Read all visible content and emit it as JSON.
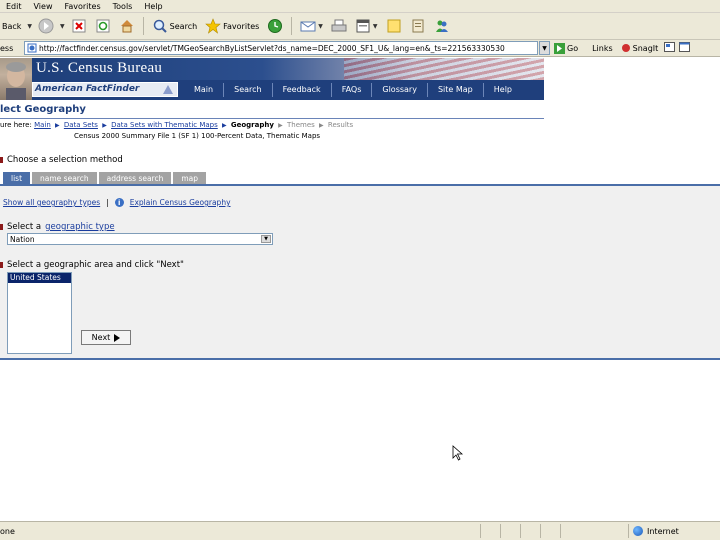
{
  "menubar": [
    "Edit",
    "View",
    "Favorites",
    "Tools",
    "Help"
  ],
  "toolbar": {
    "back_label": "Back",
    "search_label": "Search",
    "favorites_label": "Favorites"
  },
  "address": {
    "label": "ess",
    "url": "http://factfinder.census.gov/servlet/TMGeoSearchByListServlet?ds_name=DEC_2000_SF1_U&_lang=en&_ts=221563330530",
    "go_label": "Go",
    "links_label": "Links",
    "snagit_label": "SnagIt"
  },
  "banner": {
    "title": "U.S. Census Bureau",
    "logo": "American FactFinder",
    "nav": [
      "Main",
      "Search",
      "Feedback",
      "FAQs",
      "Glossary",
      "Site Map",
      "Help"
    ]
  },
  "page": {
    "title": "lect Geography",
    "breadcrumb_label": "ure here:",
    "crumbs": [
      "Main",
      "Data Sets",
      "Data Sets with Thematic Maps"
    ],
    "crumb_current": "Geography",
    "crumb_future": [
      "Themes",
      "Results"
    ],
    "subtitle": "Census 2000 Summary File 1 (SF 1) 100-Percent Data, Thematic Maps",
    "method_label": "Choose a selection method",
    "tabs": [
      "list",
      "name search",
      "address search",
      "map"
    ],
    "show_all_link": "Show all geography types",
    "explain_link": "Explain Census Geography",
    "step1_prefix": "Select a",
    "step1_link": "geographic type",
    "geo_type_value": "Nation",
    "step2_label": "Select a geographic area and click \"Next\"",
    "area_options": [
      "United States"
    ],
    "next_label": "Next"
  },
  "status": {
    "text": "one",
    "zone": "Internet"
  },
  "colors": {
    "nav_blue": "#1f3f7c",
    "tab_active": "#4a6ea8",
    "tab_inactive": "#a3a3a3",
    "selected_option": "#0a246a"
  }
}
